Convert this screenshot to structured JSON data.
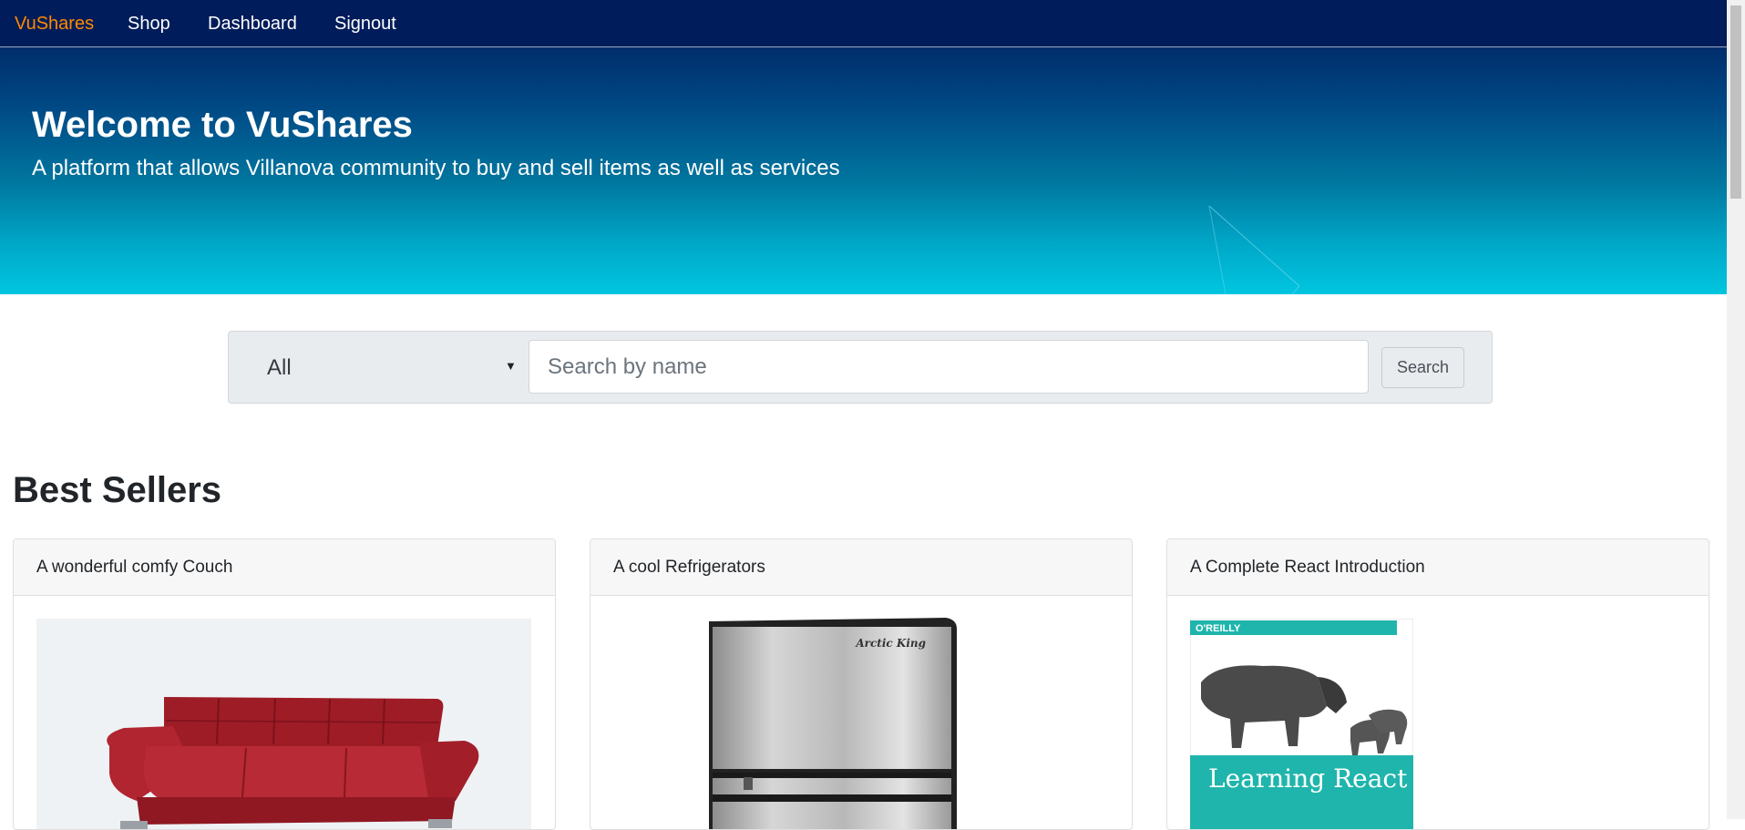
{
  "navbar": {
    "brand": "VuShares",
    "links": [
      "Shop",
      "Dashboard",
      "Signout"
    ]
  },
  "hero": {
    "title": "Welcome to VuShares",
    "subtitle": "A platform that allows Villanova community to buy and sell items as well as services"
  },
  "search": {
    "category": "All",
    "placeholder": "Search by name",
    "button_label": "Search"
  },
  "best_sellers": {
    "title": "Best Sellers",
    "items": [
      {
        "title": "A wonderful comfy Couch",
        "image": "red-couch"
      },
      {
        "title": "A cool Refrigerators",
        "image": "mini-fridge",
        "image_brand": "Arctic King"
      },
      {
        "title": "A Complete React Introduction",
        "image": "learning-react-book",
        "image_publisher": "O'REILLY",
        "image_book_title": "Learning React"
      }
    ]
  },
  "colors": {
    "navbar": "#001c5a",
    "brand": "#ff8a00",
    "hero_top": "#002d6b",
    "hero_bottom": "#00c6e0"
  }
}
